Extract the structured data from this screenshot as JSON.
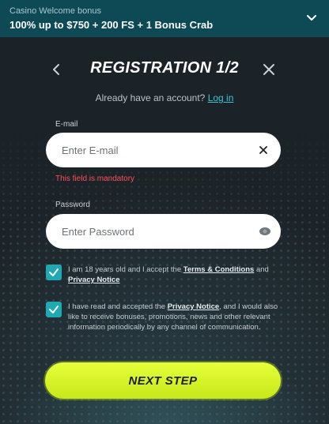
{
  "banner": {
    "subtitle": "Casino Welcome bonus",
    "offer": "100% up to $750 + 200 FS + 1 Bonus Crab"
  },
  "modal": {
    "title": "REGISTRATION 1/2",
    "already_text": "Already have an account?",
    "login_link": "Log in"
  },
  "email": {
    "label": "E-mail",
    "placeholder": "Enter E-mail",
    "value": "",
    "error": "This field is mandatory"
  },
  "password": {
    "label": "Password",
    "placeholder": "Enter Password",
    "value": ""
  },
  "consent_age": {
    "checked": true,
    "text_before": "I am 18 years old and I accept the ",
    "terms_link": "Terms & Conditions",
    "text_mid": " and ",
    "privacy_link": "Privacy Notice"
  },
  "consent_marketing": {
    "checked": true,
    "text_before": "I have read and accepted the ",
    "privacy_link": "Privacy Notice",
    "text_after": ", and I would also like to receive bonuses, promotions, news and other relevant information periodically by any channel of communication."
  },
  "next_button": {
    "label": "NEXT STEP"
  },
  "colors": {
    "banner_bg": "#0e4a55",
    "accent_teal": "#1fa9b5",
    "link": "#3fc2d4",
    "error": "#ff4d57",
    "cta": "#d8f52a"
  },
  "icons": [
    "chevron-down-icon",
    "back-arrow-icon",
    "close-icon",
    "clear-input-icon",
    "eye-icon",
    "checkmark-icon"
  ]
}
